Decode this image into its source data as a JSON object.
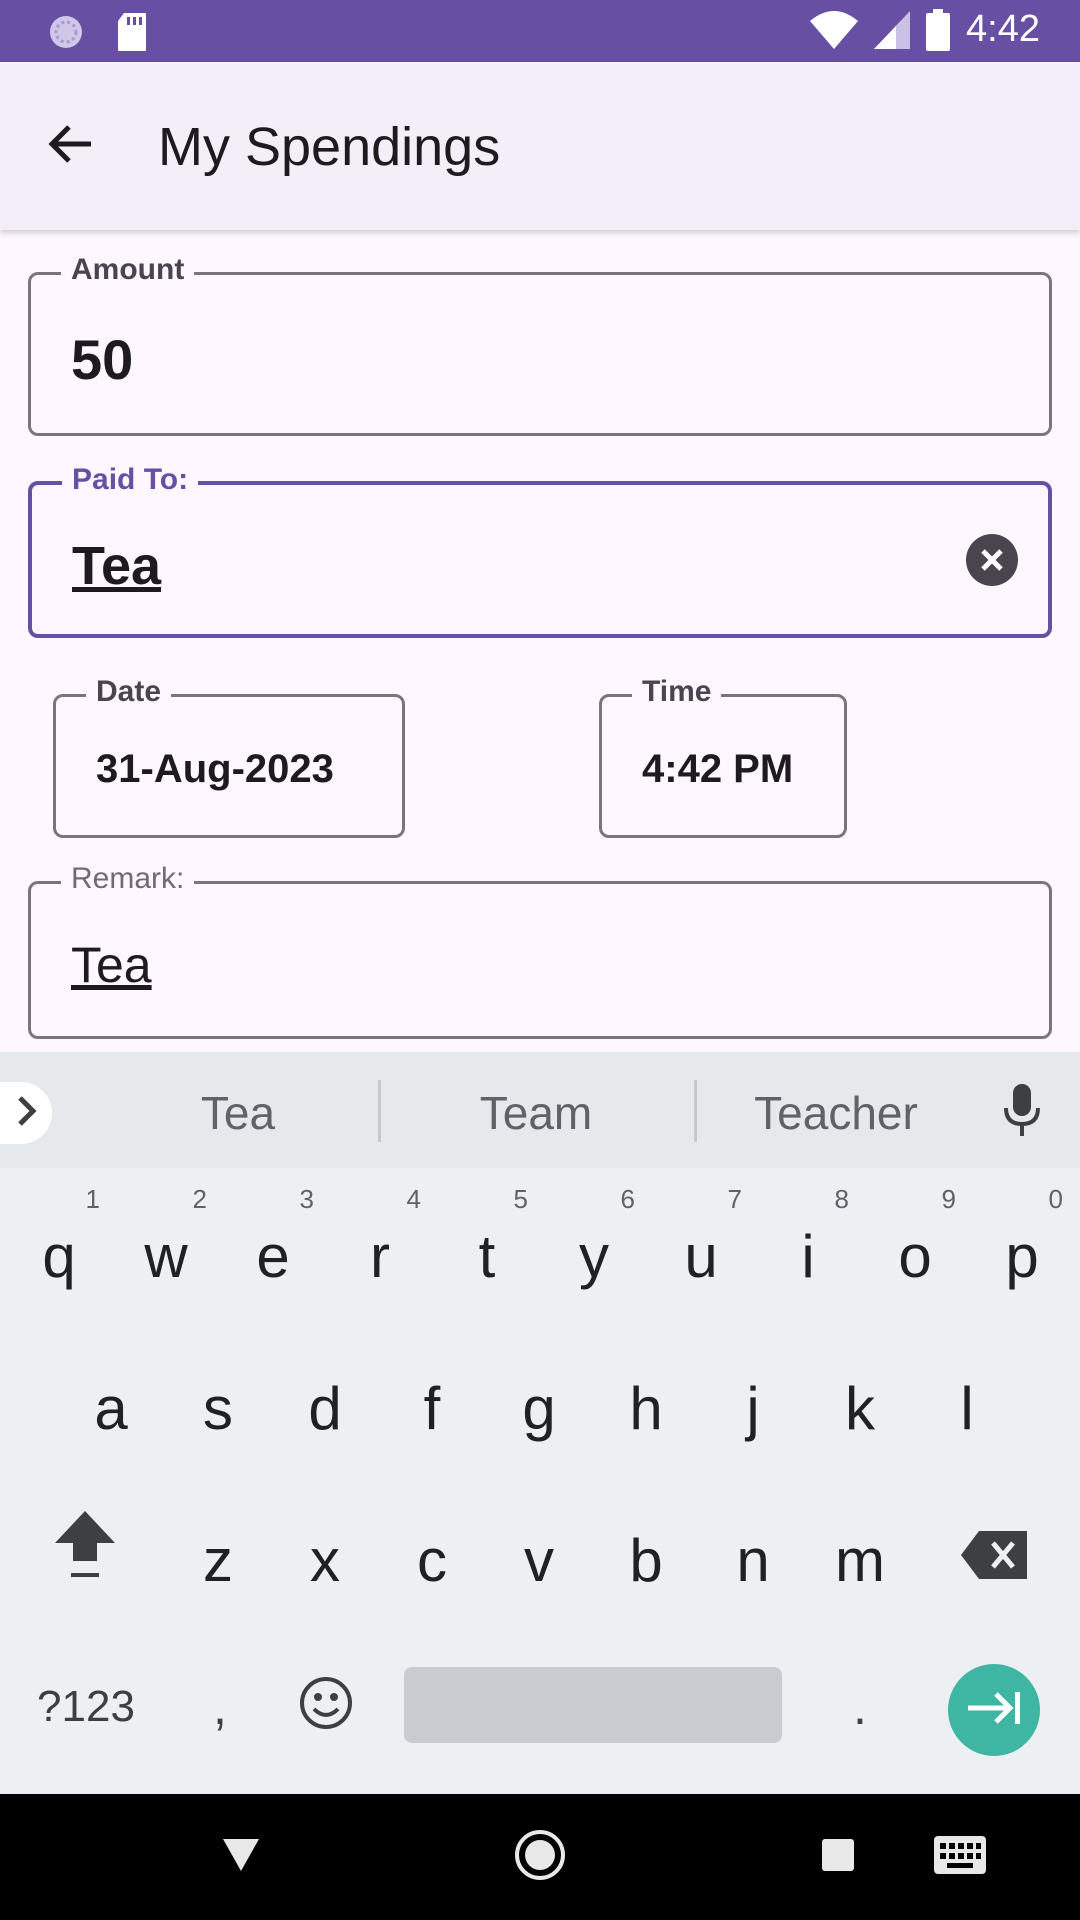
{
  "status_bar": {
    "time": "4:42"
  },
  "app_bar": {
    "title": "My Spendings"
  },
  "form": {
    "amount": {
      "label": "Amount",
      "value": "50"
    },
    "paid_to": {
      "label": "Paid To:",
      "value": "Tea"
    },
    "date": {
      "label": "Date",
      "value": "31-Aug-2023"
    },
    "time": {
      "label": "Time",
      "value": "4:42 PM"
    },
    "remark": {
      "label": "Remark:",
      "value": "Tea"
    }
  },
  "keyboard": {
    "suggestions": [
      "Tea",
      "Team",
      "Teacher"
    ],
    "row1": [
      {
        "ch": "q",
        "hint": "1"
      },
      {
        "ch": "w",
        "hint": "2"
      },
      {
        "ch": "e",
        "hint": "3"
      },
      {
        "ch": "r",
        "hint": "4"
      },
      {
        "ch": "t",
        "hint": "5"
      },
      {
        "ch": "y",
        "hint": "6"
      },
      {
        "ch": "u",
        "hint": "7"
      },
      {
        "ch": "i",
        "hint": "8"
      },
      {
        "ch": "o",
        "hint": "9"
      },
      {
        "ch": "p",
        "hint": "0"
      }
    ],
    "row2": [
      "a",
      "s",
      "d",
      "f",
      "g",
      "h",
      "j",
      "k",
      "l"
    ],
    "row3": [
      "z",
      "x",
      "c",
      "v",
      "b",
      "n",
      "m"
    ],
    "symbols_label": "?123",
    "comma": ",",
    "period": ".",
    "accent_color": "#3fb5a3"
  },
  "theme": {
    "primary": "#6750a4",
    "surface": "#fef7ff"
  }
}
